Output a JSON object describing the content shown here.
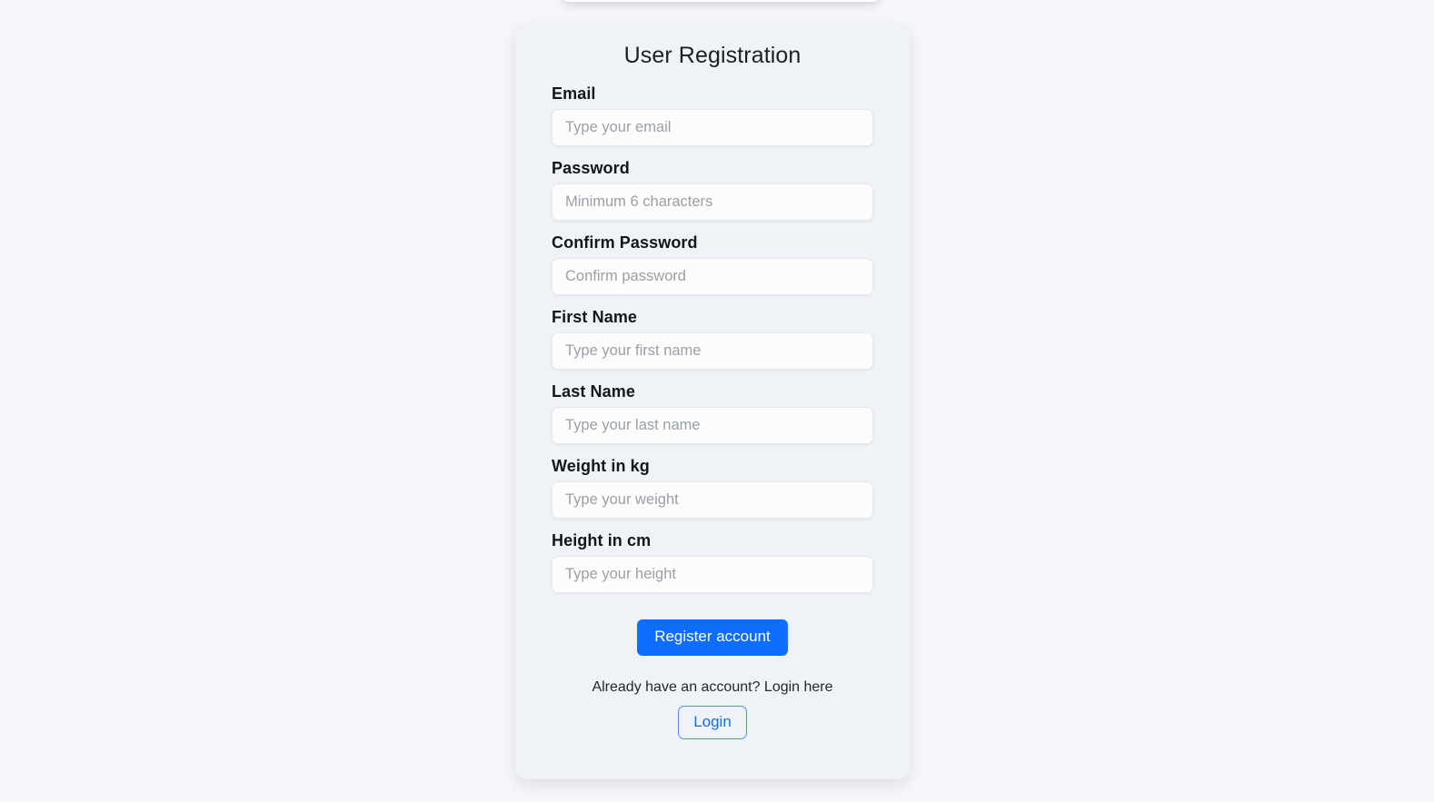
{
  "card": {
    "title": "User Registration"
  },
  "form": {
    "fields": [
      {
        "label": "Email",
        "placeholder": "Type your email",
        "name": "email"
      },
      {
        "label": "Password",
        "placeholder": "Minimum 6 characters",
        "name": "password"
      },
      {
        "label": "Confirm Password",
        "placeholder": "Confirm password",
        "name": "confirm-password"
      },
      {
        "label": "First Name",
        "placeholder": "Type your first name",
        "name": "first-name"
      },
      {
        "label": "Last Name",
        "placeholder": "Type your last name",
        "name": "last-name"
      },
      {
        "label": "Weight in kg",
        "placeholder": "Type your weight",
        "name": "weight"
      },
      {
        "label": "Height in cm",
        "placeholder": "Type your height",
        "name": "height"
      }
    ]
  },
  "actions": {
    "register_label": "Register account",
    "login_prompt": "Already have an account? Login here",
    "login_label": "Login"
  },
  "colors": {
    "page_background": "#f8f7fc",
    "card_background": "#eff2f7",
    "primary": "#0d6efd",
    "input_background": "#fcfcfc",
    "input_border": "#e7e8ea",
    "text": "#1c2024",
    "placeholder": "#9aa0a6"
  }
}
